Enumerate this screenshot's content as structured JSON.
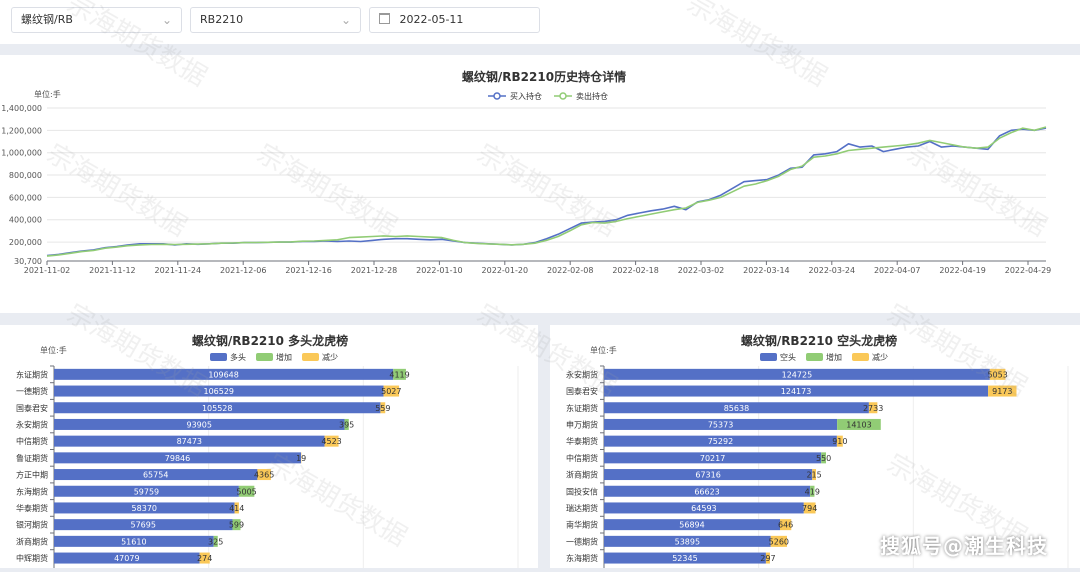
{
  "filters": {
    "product": "螺纹钢/RB",
    "contract": "RB2210",
    "date": "2022-05-11"
  },
  "line_chart": {
    "title": "螺纹钢/RB2210历史持仓详情",
    "unit": "单位:手",
    "y_ticks": [
      "1,400,000",
      "1,200,000",
      "1,000,000",
      "800,000",
      "600,000",
      "400,000",
      "200,000",
      "30,700"
    ],
    "x_ticks": [
      "2021-11-02",
      "2021-11-12",
      "2021-11-24",
      "2021-12-06",
      "2021-12-16",
      "2021-12-28",
      "2022-01-10",
      "2022-01-20",
      "2022-02-08",
      "2022-02-18",
      "2022-03-02",
      "2022-03-14",
      "2022-03-24",
      "2022-04-07",
      "2022-04-19",
      "2022-04-29"
    ],
    "legend": [
      {
        "name": "买入持仓",
        "color": "#5470c6"
      },
      {
        "name": "卖出持仓",
        "color": "#91cc75"
      }
    ]
  },
  "long_chart": {
    "title": "螺纹钢/RB2210 多头龙虎榜",
    "unit": "单位:手",
    "legend": [
      {
        "name": "多头",
        "color": "#5470c6"
      },
      {
        "name": "增加",
        "color": "#91cc75"
      },
      {
        "name": "减少",
        "color": "#fac858"
      }
    ]
  },
  "short_chart": {
    "title": "螺纹钢/RB2210 空头龙虎榜",
    "unit": "单位:手",
    "legend": [
      {
        "name": "空头",
        "color": "#5470c6"
      },
      {
        "name": "增加",
        "color": "#91cc75"
      },
      {
        "name": "减少",
        "color": "#fac858"
      }
    ]
  },
  "watermark": "宗海期货数据",
  "brand": "搜狐号@潮生科技",
  "chart_data": [
    {
      "type": "line",
      "title": "螺纹钢/RB2210历史持仓详情",
      "ylabel": "单位:手",
      "ylim": [
        30700,
        1400000
      ],
      "x_labels": [
        "2021-11-02",
        "2021-11-12",
        "2021-11-24",
        "2021-12-06",
        "2021-12-16",
        "2021-12-28",
        "2022-01-10",
        "2022-01-20",
        "2022-02-08",
        "2022-02-18",
        "2022-03-02",
        "2022-03-14",
        "2022-03-24",
        "2022-04-07",
        "2022-04-19",
        "2022-04-29"
      ],
      "series": [
        {
          "name": "买入持仓",
          "color": "#5470c6",
          "values": [
            80000,
            90000,
            105000,
            120000,
            130000,
            150000,
            160000,
            175000,
            185000,
            185000,
            185000,
            175000,
            185000,
            180000,
            185000,
            190000,
            190000,
            195000,
            195000,
            198000,
            200000,
            200000,
            205000,
            205000,
            210000,
            205000,
            210000,
            205000,
            215000,
            225000,
            230000,
            230000,
            225000,
            220000,
            225000,
            210000,
            195000,
            190000,
            185000,
            180000,
            175000,
            180000,
            195000,
            230000,
            270000,
            320000,
            370000,
            380000,
            385000,
            400000,
            440000,
            460000,
            480000,
            495000,
            520000,
            490000,
            560000,
            580000,
            620000,
            680000,
            740000,
            750000,
            760000,
            800000,
            860000,
            870000,
            980000,
            990000,
            1010000,
            1080000,
            1050000,
            1060000,
            1010000,
            1030000,
            1050000,
            1060000,
            1100000,
            1050000,
            1060000,
            1050000,
            1040000,
            1030000,
            1150000,
            1200000,
            1210000,
            1200000,
            1220000
          ]
        },
        {
          "name": "卖出持仓",
          "color": "#91cc75",
          "values": [
            75000,
            85000,
            100000,
            115000,
            125000,
            145000,
            155000,
            168000,
            175000,
            178000,
            180000,
            178000,
            180000,
            182000,
            185000,
            190000,
            192000,
            195000,
            196000,
            198000,
            200000,
            202000,
            208000,
            210000,
            215000,
            220000,
            240000,
            245000,
            250000,
            255000,
            250000,
            255000,
            250000,
            245000,
            240000,
            215000,
            195000,
            188000,
            184000,
            180000,
            176000,
            180000,
            190000,
            215000,
            250000,
            300000,
            355000,
            375000,
            370000,
            385000,
            410000,
            430000,
            450000,
            470000,
            490000,
            505000,
            555000,
            575000,
            600000,
            650000,
            700000,
            720000,
            750000,
            790000,
            850000,
            880000,
            960000,
            970000,
            990000,
            1020000,
            1030000,
            1040000,
            1050000,
            1060000,
            1070000,
            1085000,
            1110000,
            1090000,
            1070000,
            1050000,
            1040000,
            1050000,
            1130000,
            1180000,
            1220000,
            1200000,
            1230000
          ]
        }
      ]
    },
    {
      "type": "bar",
      "title": "螺纹钢/RB2210 多头龙虎榜",
      "ylabel": "单位:手",
      "xlim": [
        0,
        150000
      ],
      "categories": [
        "东证期货",
        "一德期货",
        "国泰君安",
        "永安期货",
        "中信期货",
        "鲁证期货",
        "方正中期",
        "东海期货",
        "华泰期货",
        "银河期货",
        "浙商期货",
        "中辉期货"
      ],
      "series": [
        {
          "name": "多头",
          "values": [
            109648,
            106529,
            105528,
            93905,
            87473,
            79846,
            65754,
            59759,
            58370,
            57695,
            51610,
            47079
          ]
        },
        {
          "name": "增加",
          "values": [
            4119,
            0,
            0,
            1395,
            0,
            0,
            0,
            5005,
            0,
            2599,
            1325,
            0
          ]
        },
        {
          "name": "减少",
          "values": [
            0,
            5027,
            1559,
            0,
            4523,
            119,
            4365,
            0,
            1414,
            0,
            0,
            3274
          ]
        }
      ],
      "label_texts": [
        [
          "109648",
          "106529",
          "105528",
          "93905",
          "87473",
          "79846",
          "65754",
          "59759",
          "58370",
          "57695",
          "51610",
          "47079"
        ],
        [
          "4119",
          "5027",
          "559",
          "395",
          "4523",
          "19",
          "4365",
          "5005",
          "414",
          "599",
          "325",
          "274"
        ]
      ]
    },
    {
      "type": "bar",
      "title": "螺纹钢/RB2210 空头龙虎榜",
      "ylabel": "单位:手",
      "xlim": [
        0,
        150000
      ],
      "categories": [
        "永安期货",
        "国泰君安",
        "东证期货",
        "申万期货",
        "华泰期货",
        "中信期货",
        "浙商期货",
        "国投安信",
        "瑞达期货",
        "南华期货",
        "一德期货",
        "东海期货"
      ],
      "series": [
        {
          "name": "空头",
          "values": [
            124725,
            124173,
            85638,
            75373,
            75292,
            70217,
            67316,
            66623,
            64593,
            56894,
            53895,
            52345
          ]
        },
        {
          "name": "增加",
          "values": [
            0,
            0,
            0,
            14103,
            0,
            1550,
            0,
            1419,
            0,
            0,
            0,
            0
          ]
        },
        {
          "name": "减少",
          "values": [
            5053,
            9173,
            2733,
            0,
            1910,
            0,
            1215,
            0,
            3794,
            3646,
            5260,
            1297
          ]
        }
      ],
      "label_texts": [
        [
          "124725",
          "124173",
          "85638",
          "75373",
          "75292",
          "70217",
          "67316",
          "66623",
          "64593",
          "56894",
          "53895",
          "52345"
        ],
        [
          "5053",
          "9173",
          "2733",
          "14103",
          "910",
          "550",
          "215",
          "419",
          "794",
          "646",
          "5260",
          "297"
        ]
      ]
    }
  ]
}
